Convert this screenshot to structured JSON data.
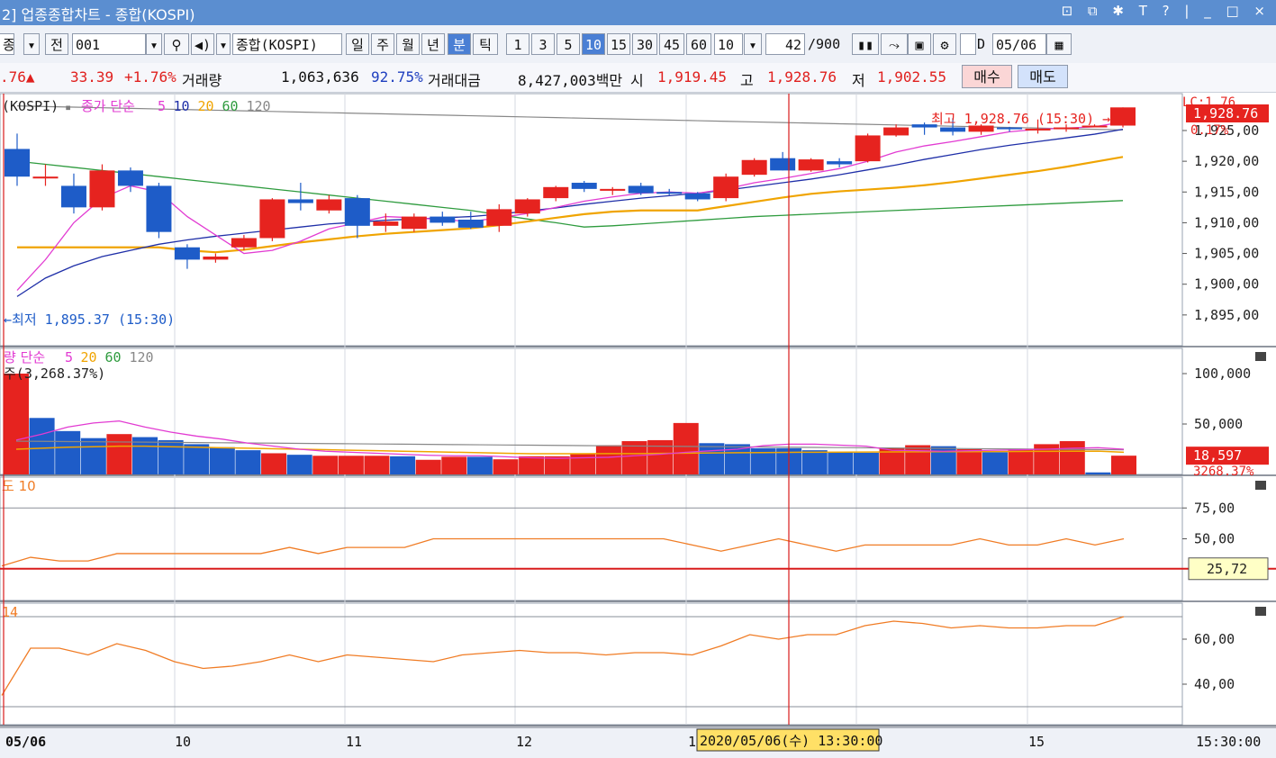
{
  "window": {
    "title": "2] 업종종합차트 - 종합(KOSPI)",
    "controls": "⊡ ⧉ ✱ T ? | _ □ ×"
  },
  "toolbar": {
    "kind": "종",
    "prev": "전",
    "code": "001",
    "name": "종합(KOSPI)",
    "periods": [
      "일",
      "주",
      "월",
      "년",
      "분",
      "틱"
    ],
    "selected_period": "분",
    "intervals": [
      "1",
      "3",
      "5",
      "10",
      "15",
      "30",
      "45",
      "60"
    ],
    "selected_interval": "10",
    "interval_value": "10",
    "count": "42",
    "count_max": "/900",
    "date_prefix": "D",
    "date": "05/06"
  },
  "quote": {
    "price_tail": ".76▲",
    "change": "33.39",
    "change_pct": "+1.76%",
    "volume_label": "거래량",
    "volume": "1,063,636",
    "volume_pct": "92.75%",
    "amount_label": "거래대금",
    "amount": "8,427,003백만",
    "open_label": "시",
    "open": "1,919.45",
    "high_label": "고",
    "high": "1,928.76",
    "low_label": "저",
    "low": "1,902.55",
    "buy_label": "매수",
    "sell_label": "매도"
  },
  "colors": {
    "up": "#e6231f",
    "down": "#1e5cc8",
    "ma5": "#e23bd2",
    "ma10": "#1f2fa8",
    "ma20": "#f0a400",
    "ma60": "#2e9b3e",
    "ma120": "#888888",
    "indicator": "#f07c25",
    "crosshair": "#d91c1c"
  },
  "chart_data": [
    {
      "type": "candlestick",
      "legend_prefix": "(KOSPI)",
      "legend_box": "▪",
      "legend_label": "종가 단순",
      "ma_periods": [
        "5",
        "10",
        "20",
        "60",
        "120"
      ],
      "ylim": [
        1890,
        1931
      ],
      "yticks": [
        "1,925,00",
        "1,920,00",
        "1,915,00",
        "1,910,00",
        "1,905,00",
        "1,900,00",
        "1,895,00"
      ],
      "ytick_values": [
        1925,
        1920,
        1915,
        1910,
        1905,
        1900,
        1895
      ],
      "right_labels": [
        "LC:1.76",
        "1,928.76",
        "0.17%"
      ],
      "max_annotation": "최고 1,928.76 (15:30) →",
      "min_annotation": "←최저 1,895.37 (15:30)",
      "x_labels": [
        "05/06",
        "10",
        "11",
        "12",
        "1",
        "15"
      ],
      "time_label": "15:30:00",
      "crosshair_tooltip": "2020/05/06(수) 13:30:00",
      "candles": [
        {
          "o": 1922,
          "h": 1924.5,
          "l": 1916,
          "c": 1917.5
        },
        {
          "o": 1917.2,
          "h": 1919.5,
          "l": 1916,
          "c": 1917.5
        },
        {
          "o": 1916,
          "h": 1918,
          "l": 1911.5,
          "c": 1912.5
        },
        {
          "o": 1912.5,
          "h": 1919.5,
          "l": 1912,
          "c": 1918.5
        },
        {
          "o": 1918.5,
          "h": 1919,
          "l": 1915,
          "c": 1916
        },
        {
          "o": 1916,
          "h": 1916.5,
          "l": 1907.5,
          "c": 1908.5
        },
        {
          "o": 1906,
          "h": 1906.5,
          "l": 1902.5,
          "c": 1904
        },
        {
          "o": 1904,
          "h": 1905,
          "l": 1903.5,
          "c": 1904.5
        },
        {
          "o": 1906,
          "h": 1908,
          "l": 1905.5,
          "c": 1907.5
        },
        {
          "o": 1907.5,
          "h": 1914,
          "l": 1907,
          "c": 1913.8
        },
        {
          "o": 1913.8,
          "h": 1916.5,
          "l": 1912,
          "c": 1913.2
        },
        {
          "o": 1912,
          "h": 1914.5,
          "l": 1911.5,
          "c": 1913.8
        },
        {
          "o": 1914,
          "h": 1914.5,
          "l": 1907.5,
          "c": 1909.5
        },
        {
          "o": 1909.5,
          "h": 1911.5,
          "l": 1908.5,
          "c": 1910.2
        },
        {
          "o": 1909,
          "h": 1911.5,
          "l": 1908.5,
          "c": 1911
        },
        {
          "o": 1911,
          "h": 1911.8,
          "l": 1909.5,
          "c": 1910
        },
        {
          "o": 1910.5,
          "h": 1911.8,
          "l": 1909,
          "c": 1909.2
        },
        {
          "o": 1909.5,
          "h": 1913,
          "l": 1908.5,
          "c": 1912.2
        },
        {
          "o": 1911.5,
          "h": 1914,
          "l": 1911,
          "c": 1913.8
        },
        {
          "o": 1914,
          "h": 1916,
          "l": 1913.5,
          "c": 1915.8
        },
        {
          "o": 1916.5,
          "h": 1916.8,
          "l": 1915,
          "c": 1915.5
        },
        {
          "o": 1915.2,
          "h": 1915.8,
          "l": 1914.5,
          "c": 1915.5
        },
        {
          "o": 1916,
          "h": 1916.5,
          "l": 1914.5,
          "c": 1914.8
        },
        {
          "o": 1915,
          "h": 1915.5,
          "l": 1914.5,
          "c": 1914.8
        },
        {
          "o": 1914.8,
          "h": 1915,
          "l": 1913.5,
          "c": 1913.8
        },
        {
          "o": 1914,
          "h": 1918,
          "l": 1913.5,
          "c": 1917.5
        },
        {
          "o": 1917.8,
          "h": 1920.5,
          "l": 1917.5,
          "c": 1920.2
        },
        {
          "o": 1920.5,
          "h": 1921.5,
          "l": 1918.5,
          "c": 1918.5
        },
        {
          "o": 1918.5,
          "h": 1920.5,
          "l": 1918.3,
          "c": 1920.3
        },
        {
          "o": 1920,
          "h": 1920.5,
          "l": 1919,
          "c": 1919.5
        },
        {
          "o": 1920,
          "h": 1924.5,
          "l": 1919.8,
          "c": 1924.2
        },
        {
          "o": 1924.2,
          "h": 1926,
          "l": 1924,
          "c": 1925.5
        },
        {
          "o": 1926,
          "h": 1926.3,
          "l": 1924.3,
          "c": 1925.5
        },
        {
          "o": 1925.5,
          "h": 1927,
          "l": 1924.2,
          "c": 1924.8
        },
        {
          "o": 1924.8,
          "h": 1926,
          "l": 1924.3,
          "c": 1925.8
        },
        {
          "o": 1925.5,
          "h": 1925.6,
          "l": 1924.8,
          "c": 1925.3
        },
        {
          "o": 1925.2,
          "h": 1926.8,
          "l": 1924.5,
          "c": 1925.3
        },
        {
          "o": 1925.5,
          "h": 1926,
          "l": 1924.8,
          "c": 1925.5
        },
        {
          "o": 1925.8,
          "h": 1926,
          "l": 1925.6,
          "c": 1925.8
        },
        {
          "o": 1925.8,
          "h": 1928.76,
          "l": 1925.5,
          "c": 1928.76
        }
      ],
      "ma_lines": {
        "ma5": [
          1899,
          1904,
          1910,
          1914,
          1916,
          1915,
          1911,
          1908,
          1905,
          1905.5,
          1907,
          1909,
          1910,
          1911,
          1910.8,
          1910.5,
          1910.2,
          1910.8,
          1911.5,
          1912.5,
          1913.5,
          1914.2,
          1914.8,
          1915,
          1914.8,
          1915.5,
          1916.5,
          1917.2,
          1918,
          1918.8,
          1920,
          1921.5,
          1922.5,
          1923.2,
          1924,
          1924.8,
          1925.2,
          1925.4,
          1925.6,
          1926.4
        ],
        "ma10": [
          1898,
          1901,
          1903,
          1904.5,
          1905.5,
          1906.5,
          1907.2,
          1907.8,
          1908.3,
          1908.8,
          1909.3,
          1909.8,
          1910.1,
          1910.4,
          1910.6,
          1910.8,
          1911,
          1911.4,
          1911.9,
          1912.4,
          1913,
          1913.5,
          1914,
          1914.4,
          1914.8,
          1915.3,
          1915.9,
          1916.5,
          1917.1,
          1917.8,
          1918.6,
          1919.4,
          1920.3,
          1921.1,
          1921.9,
          1922.6,
          1923.2,
          1923.8,
          1924.4,
          1925.2
        ],
        "ma20": [
          1906,
          1906,
          1906,
          1906,
          1906,
          1906,
          1905.5,
          1905.2,
          1905.6,
          1906.2,
          1906.8,
          1907.3,
          1907.8,
          1908.2,
          1908.5,
          1908.8,
          1909.1,
          1909.6,
          1910.2,
          1910.8,
          1911.4,
          1911.8,
          1912,
          1912,
          1912,
          1912.7,
          1913.4,
          1914.1,
          1914.7,
          1915.1,
          1915.4,
          1915.7,
          1916.1,
          1916.6,
          1917.2,
          1917.8,
          1918.4,
          1919.1,
          1919.9,
          1920.7
        ],
        "ma60": [
          1920,
          1919.5,
          1919,
          1918.5,
          1918,
          1917.5,
          1917,
          1916.5,
          1916,
          1915.5,
          1915,
          1914.5,
          1914,
          1913.5,
          1913,
          1912.5,
          1912,
          1911.3,
          1910.6,
          1910,
          1909.3,
          1909.5,
          1909.8,
          1910.1,
          1910.4,
          1910.7,
          1911,
          1911.2,
          1911.4,
          1911.6,
          1911.8,
          1912,
          1912.2,
          1912.4,
          1912.6,
          1912.8,
          1913,
          1913.2,
          1913.4,
          1913.6
        ],
        "ma120": [
          1929,
          1928.9,
          1928.8,
          1928.7,
          1928.6,
          1928.5,
          1928.4,
          1928.3,
          1928.2,
          1928.1,
          1928,
          1927.9,
          1927.8,
          1927.7,
          1927.6,
          1927.5,
          1927.4,
          1927.3,
          1927.2,
          1927.1,
          1927,
          1926.9,
          1926.8,
          1926.7,
          1926.6,
          1926.5,
          1926.4,
          1926.3,
          1926.2,
          1926.1,
          1926,
          1925.9,
          1925.8,
          1925.7,
          1925.6,
          1925.5,
          1925.4,
          1925.3,
          1925.2,
          1925.1
        ]
      }
    },
    {
      "type": "bar",
      "legend_label": "량 단순",
      "legend_sub": "주(3,268.37%)",
      "ma_periods": [
        "5",
        "20",
        "60",
        "120"
      ],
      "ylim": [
        0,
        125000
      ],
      "yticks": [
        "100,000",
        "50,000"
      ],
      "ytick_values": [
        100000,
        50000
      ],
      "right_labels": [
        "18,597",
        "3268.37%"
      ],
      "values": [
        100000,
        56000,
        43000,
        36000,
        40000,
        37000,
        34000,
        30000,
        27000,
        24000,
        21000,
        19500,
        18500,
        18500,
        18500,
        18000,
        14500,
        17500,
        17500,
        15000,
        18000,
        18000,
        21000,
        29000,
        33000,
        34000,
        51000,
        31000,
        30000,
        26000,
        26000,
        24000,
        22000,
        21500,
        26000,
        29000,
        28000,
        25000,
        22000,
        25000,
        30000,
        33000,
        2000,
        18597
      ],
      "colors": [
        "up",
        "down",
        "down",
        "down",
        "up",
        "down",
        "down",
        "down",
        "down",
        "down",
        "up",
        "down",
        "up",
        "up",
        "up",
        "down",
        "up",
        "up",
        "down",
        "up",
        "up",
        "up",
        "up",
        "up",
        "up",
        "up",
        "up",
        "down",
        "down",
        "down",
        "down",
        "down",
        "down",
        "down",
        "up",
        "up",
        "down",
        "up",
        "down",
        "up",
        "up",
        "up",
        "down",
        "up"
      ],
      "ma5": [
        34000,
        40000,
        47000,
        51000,
        53000,
        47000,
        42000,
        38000,
        35000,
        31000,
        28000,
        25000,
        23000,
        22000,
        21000,
        20000,
        19000,
        18500,
        18500,
        17500,
        16500,
        16000,
        16500,
        17000,
        18500,
        20000,
        22000,
        23500,
        25000,
        28500,
        30000,
        30000,
        29000,
        28000,
        24000,
        23500,
        23000,
        23500,
        24000,
        24500,
        25000,
        26000,
        26500,
        25000
      ],
      "ma20": [
        25000,
        26000,
        27000,
        27500,
        28000,
        28000,
        27500,
        27000,
        26500,
        26000,
        25500,
        25000,
        24500,
        24000,
        23500,
        23000,
        22500,
        22000,
        21500,
        21000,
        20500,
        20500,
        20500,
        20600,
        20700,
        20900,
        21100,
        21300,
        21500,
        21700,
        21900,
        22000,
        22100,
        22200,
        22300,
        22400,
        22500,
        22600,
        22700,
        22800,
        22900,
        23000,
        23100,
        22000
      ],
      "ma60": [
        33000,
        32800,
        32600,
        32400,
        32200,
        32000,
        31800,
        31600,
        31400,
        31200,
        31000,
        30800,
        30600,
        30400,
        30200,
        30000,
        29800,
        29600,
        29400,
        29200,
        29000,
        28800,
        28600,
        28400,
        28200,
        28000,
        27800,
        27600,
        27400,
        27200,
        27000,
        26800,
        26600,
        26400,
        26200,
        26000,
        25800,
        25600,
        25400,
        25200,
        25000,
        24800,
        24600,
        24400
      ]
    },
    {
      "type": "line",
      "legend_label": "도 10",
      "ylim": [
        0,
        100
      ],
      "yticks": [
        "75,00",
        "50,00"
      ],
      "ytick_values": [
        75,
        50
      ],
      "current_value": "25,72",
      "reference_line": 25.72,
      "values": [
        28,
        35,
        32,
        32,
        38,
        38,
        38,
        38,
        38,
        38,
        43,
        38,
        43,
        43,
        43,
        50,
        50,
        50,
        50,
        50,
        50,
        50,
        50,
        50,
        45,
        40,
        45,
        50,
        45,
        40,
        45,
        45,
        45,
        45,
        50,
        45,
        45,
        50,
        45,
        50
      ]
    },
    {
      "type": "line",
      "legend_label": "14",
      "ylim": [
        22,
        76
      ],
      "yticks": [
        "60,00",
        "40,00"
      ],
      "ytick_values": [
        60,
        40
      ],
      "values": [
        35,
        56,
        56,
        53,
        58,
        55,
        50,
        47,
        48,
        50,
        53,
        50,
        53,
        52,
        51,
        50,
        53,
        54,
        55,
        54,
        54,
        53,
        54,
        54,
        53,
        57,
        62,
        60,
        62,
        62,
        66,
        68,
        67,
        65,
        66,
        65,
        65,
        66,
        66,
        70
      ]
    }
  ]
}
